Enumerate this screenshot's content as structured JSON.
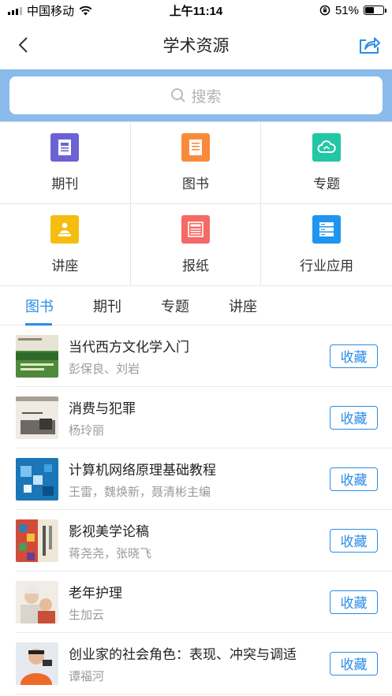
{
  "status": {
    "carrier": "中国移动",
    "time": "上午11:14",
    "battery": "51%",
    "battery_level": 0.51
  },
  "header": {
    "title": "学术资源",
    "back_icon": "chevron-left-icon",
    "share_icon": "share-icon"
  },
  "search": {
    "placeholder": "搜索"
  },
  "categories": [
    {
      "label": "期刊",
      "icon": "journal-icon",
      "color": "#6b63d4"
    },
    {
      "label": "图书",
      "icon": "book-icon",
      "color": "#fa8a3a"
    },
    {
      "label": "专题",
      "icon": "cloud-icon",
      "color": "#22c7a4"
    },
    {
      "label": "讲座",
      "icon": "lecture-icon",
      "color": "#f5bd0f"
    },
    {
      "label": "报纸",
      "icon": "newspaper-icon",
      "color": "#f56a67"
    },
    {
      "label": "行业应用",
      "icon": "server-icon",
      "color": "#1f95ef"
    }
  ],
  "tabs": [
    "图书",
    "期刊",
    "专题",
    "讲座"
  ],
  "active_tab": "图书",
  "accent": "#2a8ce8",
  "books": [
    {
      "title": "当代西方文化学入门",
      "author": "彭保良、刘岩",
      "action": "收藏"
    },
    {
      "title": "消费与犯罪",
      "author": "杨玲丽",
      "action": "收藏"
    },
    {
      "title": "计算机网络原理基础教程",
      "author": "王雷，魏焕新，聂清彬主编",
      "action": "收藏"
    },
    {
      "title": "影视美学论稿",
      "author": "蒋尧尧，张晓飞",
      "action": "收藏"
    },
    {
      "title": "老年护理",
      "author": "生加云",
      "action": "收藏"
    },
    {
      "title": "创业家的社会角色：表现、冲突与调适",
      "author": "谭福河",
      "action": "收藏"
    }
  ]
}
